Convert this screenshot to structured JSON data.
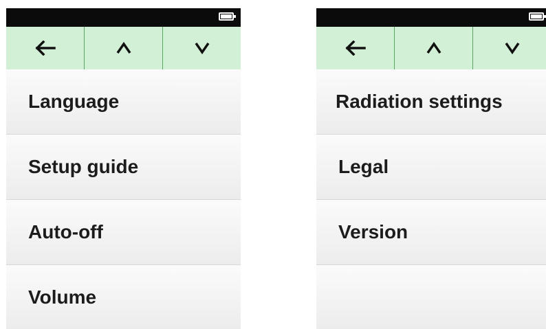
{
  "battery": {
    "icon": "battery-icon",
    "level": 1.0
  },
  "nav": {
    "back_icon": "arrow-left-icon",
    "up_icon": "chevron-up-icon",
    "down_icon": "chevron-down-icon",
    "background": "#d2f0d5",
    "divider_color": "#55a85d"
  },
  "screens": [
    {
      "items": [
        {
          "label": "Language"
        },
        {
          "label": "Setup guide"
        },
        {
          "label": "Auto-off"
        },
        {
          "label": "Volume"
        }
      ]
    },
    {
      "items": [
        {
          "label": "Radiation settings"
        },
        {
          "label": "Legal"
        },
        {
          "label": "Version"
        },
        {
          "label": ""
        }
      ]
    }
  ]
}
